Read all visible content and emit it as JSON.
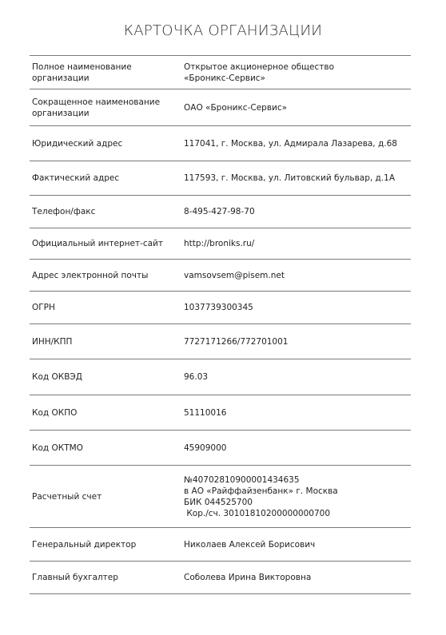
{
  "title": "КАРТОЧКА ОРГАНИЗАЦИИ",
  "rows": [
    {
      "label": "Полное наименование организации",
      "value": [
        "Открытое акционерное общество",
        "«Броникс-Сервис»"
      ]
    },
    {
      "label": "Сокращенное наименование организации",
      "value": [
        "ОАО «Броникс-Сервис»"
      ]
    },
    {
      "label": "Юридический адрес",
      "value": [
        "117041, г. Москва, ул. Адмирала Лазарева, д.68"
      ]
    },
    {
      "label": "Фактический адрес",
      "value": [
        "117593, г. Москва, ул. Литовский бульвар, д.1А"
      ]
    },
    {
      "label": "Телефон/факс",
      "value": [
        "8-495-427-98-70"
      ]
    },
    {
      "label": "Официальный интернет-сайт",
      "value": [
        "http://broniks.ru/"
      ]
    },
    {
      "label": "Адрес электронной почты",
      "value": [
        "vamsovsem@pisem.net"
      ]
    },
    {
      "label": "ОГРН",
      "value": [
        "1037739300345"
      ]
    },
    {
      "label": "ИНН/КПП",
      "value": [
        "7727171266/772701001"
      ]
    },
    {
      "label": "Код ОКВЭД",
      "value": [
        "96.03"
      ]
    },
    {
      "label": "Код ОКПО",
      "value": [
        "51110016"
      ]
    },
    {
      "label": "Код ОКТМО",
      "value": [
        "45909000"
      ]
    },
    {
      "label": "Расчетный счет",
      "value": [
        "№40702810900001434635",
        "в АО «Райффайзенбанк» г. Москва",
        "БИК 044525700",
        " Кор./сч. 30101810200000000700"
      ]
    },
    {
      "label": "Генеральный директор",
      "value": [
        "Николаев Алексей Борисович"
      ]
    },
    {
      "label": "Главный бухгалтер",
      "value": [
        "Соболева Ирина Викторовна"
      ]
    }
  ]
}
